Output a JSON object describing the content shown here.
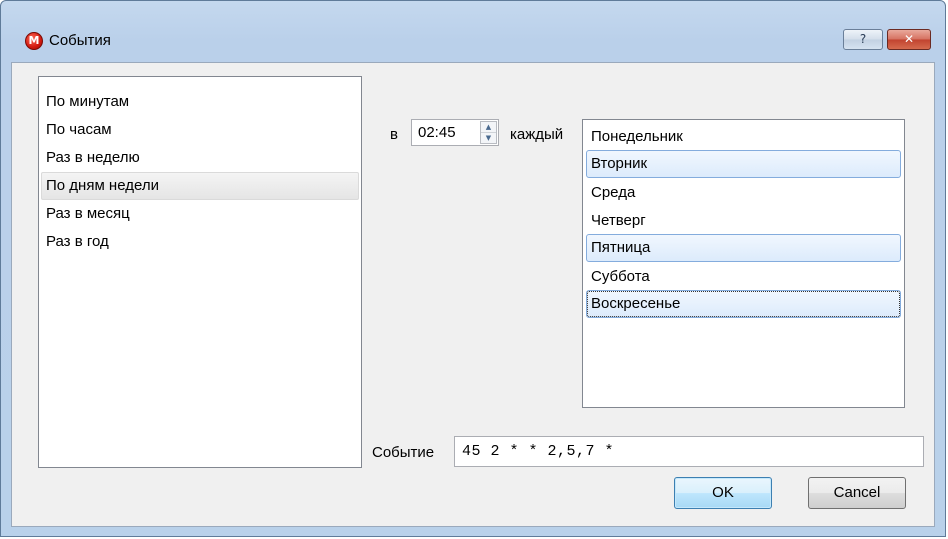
{
  "window": {
    "title": "События",
    "app_icon_letter": "M",
    "help_label": "?",
    "close_label": "✕"
  },
  "modes": {
    "items": [
      "По минутам",
      "По часам",
      "Раз в неделю",
      "По дням недели",
      "Раз в месяц",
      "Раз в год"
    ],
    "selected": "По дням недели"
  },
  "schedule": {
    "at_label": "в",
    "time_value": "02:45",
    "each_label": "каждый"
  },
  "days": {
    "items": [
      "Понедельник",
      "Вторник",
      "Среда",
      "Четверг",
      "Пятница",
      "Суббота",
      "Воскресенье"
    ],
    "selected": [
      "Вторник",
      "Пятница",
      "Воскресенье"
    ],
    "focused": "Воскресенье"
  },
  "event": {
    "label": "Событие",
    "value": "45 2 * * 2,5,7 *"
  },
  "buttons": {
    "ok_label": "OK",
    "cancel_label": "Cancel"
  },
  "colors": {
    "selection_fill": "#dcebfc",
    "selection_border": "#84acdd",
    "title_gradient": "#bad0ea",
    "close_button": "#c1432f"
  }
}
